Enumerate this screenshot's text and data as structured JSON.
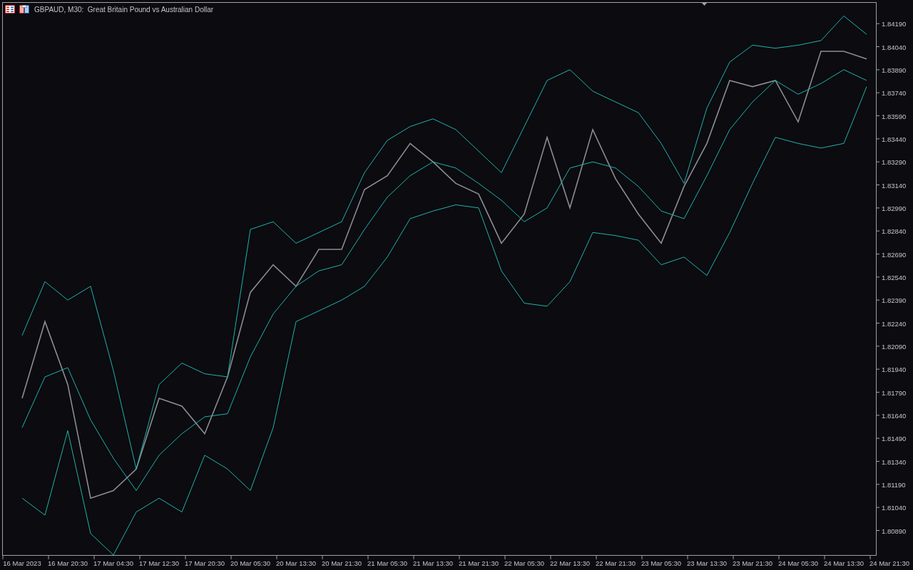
{
  "window": {
    "title": "GBPAUD, M30:  Great Britain Pound vs Australian Dollar"
  },
  "chart": {
    "chart_data": {
      "type": "line",
      "ylim": [
        1.8073,
        1.8433
      ],
      "categories": [
        "16 Mar 2023",
        null,
        "16 Mar 20:30",
        null,
        "17 Mar 04:30",
        null,
        "17 Mar 12:30",
        null,
        "17 Mar 20:30",
        null,
        "20 Mar 05:30",
        null,
        "20 Mar 13:30",
        null,
        "20 Mar 21:30",
        null,
        "21 Mar 05:30",
        null,
        "21 Mar 13:30",
        null,
        "21 Mar 21:30",
        null,
        "22 Mar 05:30",
        null,
        "22 Mar 13:30",
        null,
        "22 Mar 21:30",
        null,
        "23 Mar 05:30",
        null,
        "23 Mar 13:30",
        null,
        "23 Mar 21:30",
        null,
        "24 Mar 05:30",
        null,
        "24 Mar 13:30",
        null,
        "24 Mar 21:30"
      ],
      "yticks": [
        {
          "value": 1.8419,
          "label": "1.84190"
        },
        {
          "value": 1.8404,
          "label": "1.84040"
        },
        {
          "value": 1.8389,
          "label": "1.83890"
        },
        {
          "value": 1.8374,
          "label": "1.83740"
        },
        {
          "value": 1.8359,
          "label": "1.83590"
        },
        {
          "value": 1.8344,
          "label": "1.83440"
        },
        {
          "value": 1.8329,
          "label": "1.83290"
        },
        {
          "value": 1.8314,
          "label": "1.83140"
        },
        {
          "value": 1.8299,
          "label": "1.82990"
        },
        {
          "value": 1.8284,
          "label": "1.82840"
        },
        {
          "value": 1.8269,
          "label": "1.82690"
        },
        {
          "value": 1.8254,
          "label": "1.82540"
        },
        {
          "value": 1.8239,
          "label": "1.82390"
        },
        {
          "value": 1.8224,
          "label": "1.82240"
        },
        {
          "value": 1.8209,
          "label": "1.82090"
        },
        {
          "value": 1.8194,
          "label": "1.81940"
        },
        {
          "value": 1.8179,
          "label": "1.81790"
        },
        {
          "value": 1.8164,
          "label": "1.81640"
        },
        {
          "value": 1.8149,
          "label": "1.81490"
        },
        {
          "value": 1.8134,
          "label": "1.81340"
        },
        {
          "value": 1.8119,
          "label": "1.81190"
        },
        {
          "value": 1.8104,
          "label": "1.81040"
        },
        {
          "value": 1.8089,
          "label": "1.80890"
        }
      ],
      "series": [
        {
          "color": "#8c8c94",
          "values": [
            1.8175,
            1.8225,
            1.8184,
            1.811,
            1.8115,
            1.8129,
            1.8175,
            1.817,
            1.8152,
            1.8189,
            1.8244,
            1.8262,
            1.8248,
            1.8272,
            1.8272,
            1.8311,
            1.832,
            1.8341,
            1.8329,
            1.8315,
            1.8308,
            1.8276,
            1.8295,
            1.8345,
            1.8299,
            1.835,
            1.8318,
            1.8295,
            1.8276,
            1.8313,
            1.8341,
            1.8382,
            1.8378,
            1.8382,
            1.8355,
            1.8401,
            1.8401,
            1.8396,
            null
          ]
        },
        {
          "color": "#20b2aa",
          "values": [
            1.8216,
            1.8251,
            1.8239,
            1.8248,
            1.8193,
            1.8129,
            1.8184,
            1.8198,
            1.8191,
            1.8189,
            1.8285,
            1.829,
            1.8276,
            1.8283,
            1.829,
            1.8322,
            1.8343,
            1.8352,
            1.8357,
            1.835,
            1.8336,
            1.8322,
            1.8352,
            1.8382,
            1.8389,
            1.8375,
            1.8368,
            1.8361,
            1.8341,
            1.8315,
            1.8364,
            1.8394,
            1.8405,
            1.8403,
            1.8405,
            1.8408,
            1.8424,
            1.8412,
            null
          ]
        },
        {
          "color": "#20b2aa",
          "values": [
            1.8156,
            1.8189,
            1.8195,
            1.8161,
            1.8136,
            1.8115,
            1.8138,
            1.8152,
            1.8163,
            1.8165,
            1.8202,
            1.823,
            1.8248,
            1.8258,
            1.8262,
            1.8285,
            1.8306,
            1.832,
            1.8329,
            1.8325,
            1.8315,
            1.8304,
            1.829,
            1.8299,
            1.8325,
            1.8329,
            1.8325,
            1.8313,
            1.8297,
            1.8292,
            1.832,
            1.835,
            1.8368,
            1.8382,
            1.8373,
            1.838,
            1.8389,
            1.8382,
            null
          ]
        },
        {
          "color": "#20b2aa",
          "values": [
            1.811,
            1.8099,
            1.8154,
            1.8087,
            1.8073,
            1.8101,
            1.811,
            1.8101,
            1.8138,
            1.8129,
            1.8115,
            1.8156,
            1.8225,
            1.8232,
            1.8239,
            1.8248,
            1.8267,
            1.8292,
            1.8297,
            1.8301,
            1.8299,
            1.8258,
            1.8237,
            1.8235,
            1.8251,
            1.8283,
            1.8281,
            1.8278,
            1.8262,
            1.8267,
            1.8255,
            1.8283,
            1.8315,
            1.8345,
            1.8341,
            1.8338,
            1.8341,
            1.8378,
            null
          ]
        }
      ]
    }
  }
}
